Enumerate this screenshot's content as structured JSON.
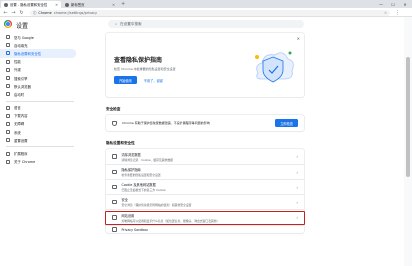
{
  "browser": {
    "tabs": [
      {
        "label": "设置 - 隐私设置和安全性"
      },
      {
        "label": "新标签页"
      }
    ],
    "new_tab": "+",
    "address_prefix": "Chrome",
    "address_url": "chrome://settings/privacy",
    "window_controls": [
      "—",
      "☐",
      "✕"
    ]
  },
  "header": {
    "title": "设置",
    "search_placeholder": "在设置中搜索"
  },
  "sidebar": {
    "items": [
      {
        "label": "您与 Google"
      },
      {
        "label": "自动填充"
      },
      {
        "label": "隐私设置和安全性"
      },
      {
        "label": "性能"
      },
      {
        "label": "外观"
      },
      {
        "label": "搜索引擎"
      },
      {
        "label": "默认浏览器"
      },
      {
        "label": "启动时"
      },
      {
        "label": "语言"
      },
      {
        "label": "下载内容"
      },
      {
        "label": "无障碍"
      },
      {
        "label": "系统"
      },
      {
        "label": "重置设置"
      },
      {
        "label": "扩展程序"
      },
      {
        "label": "关于 Chrome"
      }
    ]
  },
  "promo": {
    "title": "查看隐私保护指南",
    "description": "检查 Chrome 中最重要的隐私设置和安全设置",
    "primary_button": "开始使用",
    "secondary_button": "不用了，谢谢"
  },
  "safety_check": {
    "section_title": "安全检查",
    "text": "Chrome 有助于保护您免受数据泄露、不良扩展程序等问题的影响",
    "button": "立即检查"
  },
  "privacy": {
    "section_title": "隐私设置和安全性",
    "rows": [
      {
        "title": "清除浏览数据",
        "subtitle": "清除浏览记录、Cookie、缓存及其他数据"
      },
      {
        "title": "隐私保护指南",
        "subtitle": "检查重要的隐私设置和安全设置"
      },
      {
        "title": "Cookie 及其他网站数据",
        "subtitle": "已阻止无痕模式下的第三方 Cookie"
      },
      {
        "title": "安全",
        "subtitle": "安全浏览（保护您免受危险网站的侵害）和其他安全设置"
      },
      {
        "title": "网站设置",
        "subtitle": "控制网站可以使用和显示什么信息（如位置信息、摄像头、弹出式窗口及其他）"
      },
      {
        "title": "Privacy Sandbox",
        "subtitle": ""
      }
    ]
  },
  "colors": {
    "accent": "#1a73e8",
    "highlight": "#c5221f"
  }
}
